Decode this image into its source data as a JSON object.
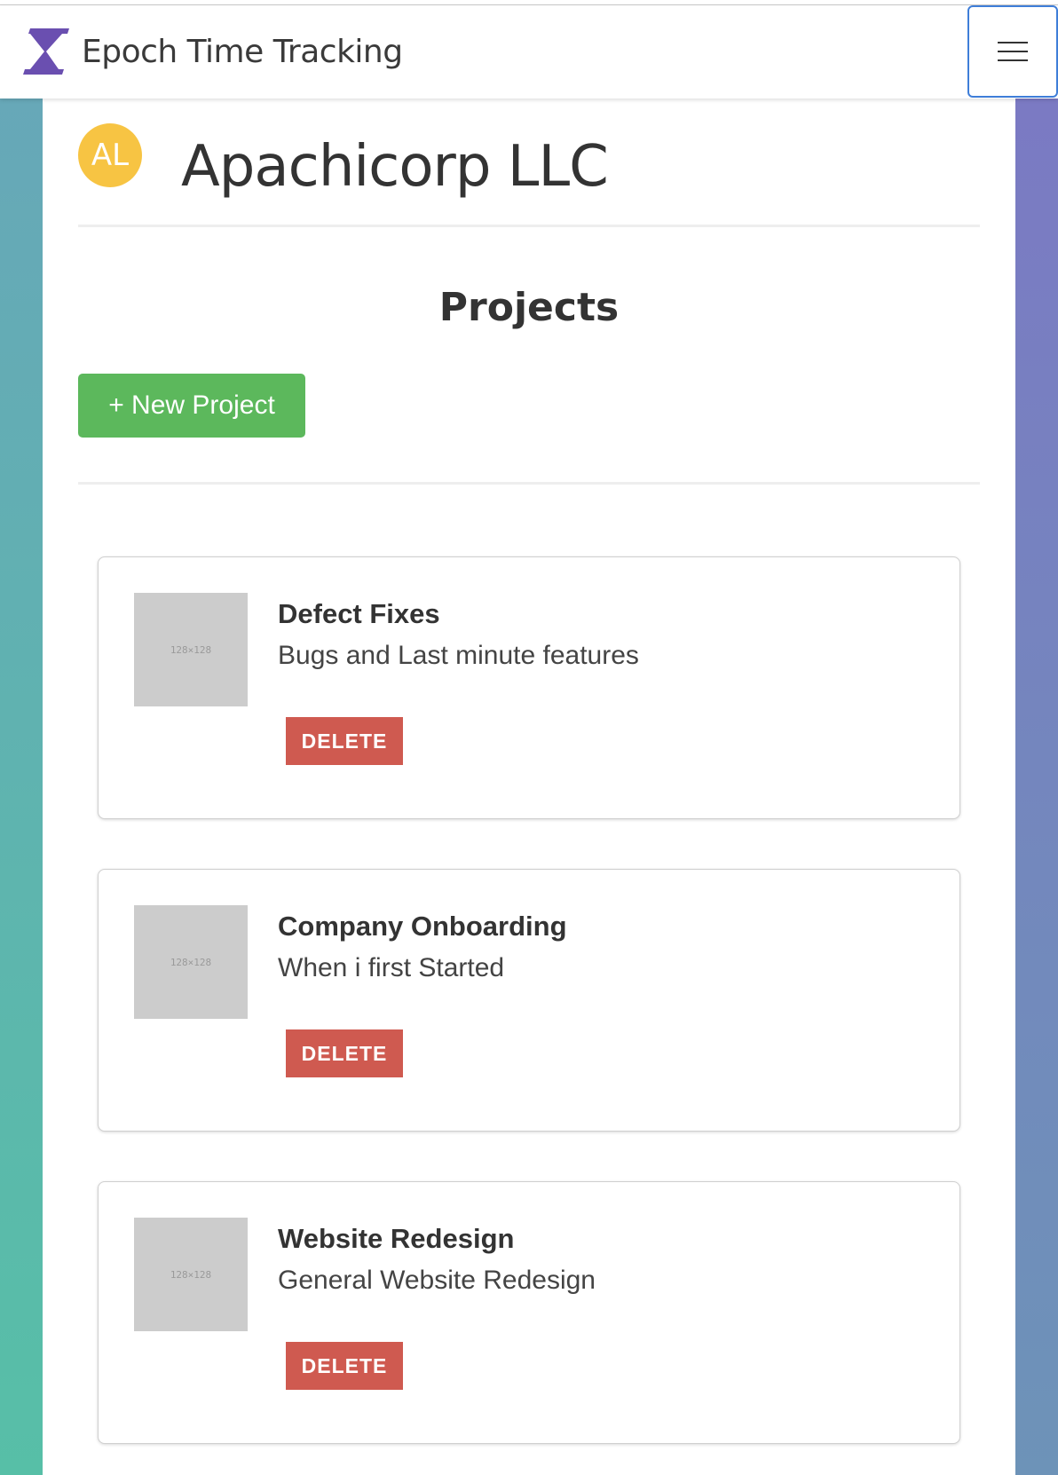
{
  "navbar": {
    "brand_title": "Epoch Time Tracking",
    "logo_icon": "hourglass-icon",
    "menu_icon": "hamburger-menu-icon"
  },
  "company": {
    "avatar_initials": "AL",
    "name": "Apachicorp LLC",
    "avatar_color": "#f7c443"
  },
  "projects_section": {
    "heading": "Projects",
    "new_project_label": "+ New Project",
    "new_project_color": "#5cb85c"
  },
  "projects": [
    {
      "name": "Defect Fixes",
      "description": "Bugs and Last minute features",
      "thumbnail_text": "128×128",
      "delete_label": "DELETE"
    },
    {
      "name": "Company Onboarding",
      "description": "When i first Started",
      "thumbnail_text": "128×128",
      "delete_label": "DELETE"
    },
    {
      "name": "Website Redesign",
      "description": "General Website Redesign",
      "thumbnail_text": "128×128",
      "delete_label": "DELETE"
    }
  ],
  "colors": {
    "delete": "#cf5a50",
    "brand_logo": "#6a4fb0",
    "menu_focus_border": "#3f7ed8"
  }
}
